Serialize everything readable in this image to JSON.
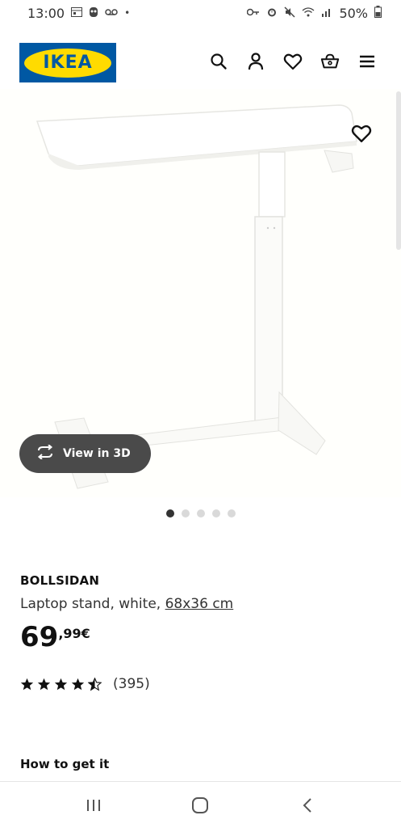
{
  "status_bar": {
    "time": "13:00",
    "battery": "50%",
    "left_icons": [
      "calendar-icon",
      "notification-icon",
      "voicemail-icon",
      "dot-icon"
    ],
    "right_icons": [
      "key-icon",
      "alarm-icon",
      "mute-icon",
      "wifi-icon",
      "signal-icon",
      "battery-icon"
    ]
  },
  "header": {
    "logo_text": "IKEA",
    "icons": [
      "search-icon",
      "account-icon",
      "favourites-icon",
      "basket-icon",
      "menu-icon"
    ]
  },
  "gallery": {
    "view_3d_label": "View in 3D",
    "dot_count": 5,
    "active_dot": 0
  },
  "product": {
    "name": "BOLLSIDAN",
    "description": "Laptop stand, white,",
    "size": "68x36 cm",
    "price_integer": "69",
    "price_decimal": ",99€",
    "rating_stars": 4.5,
    "rating_count": "(395)"
  },
  "sections": {
    "how_to_get": "How to get it"
  },
  "colors": {
    "ikea_blue": "#0058a3",
    "ikea_yellow": "#ffdb00",
    "pill_bg": "#4a4a4a"
  }
}
